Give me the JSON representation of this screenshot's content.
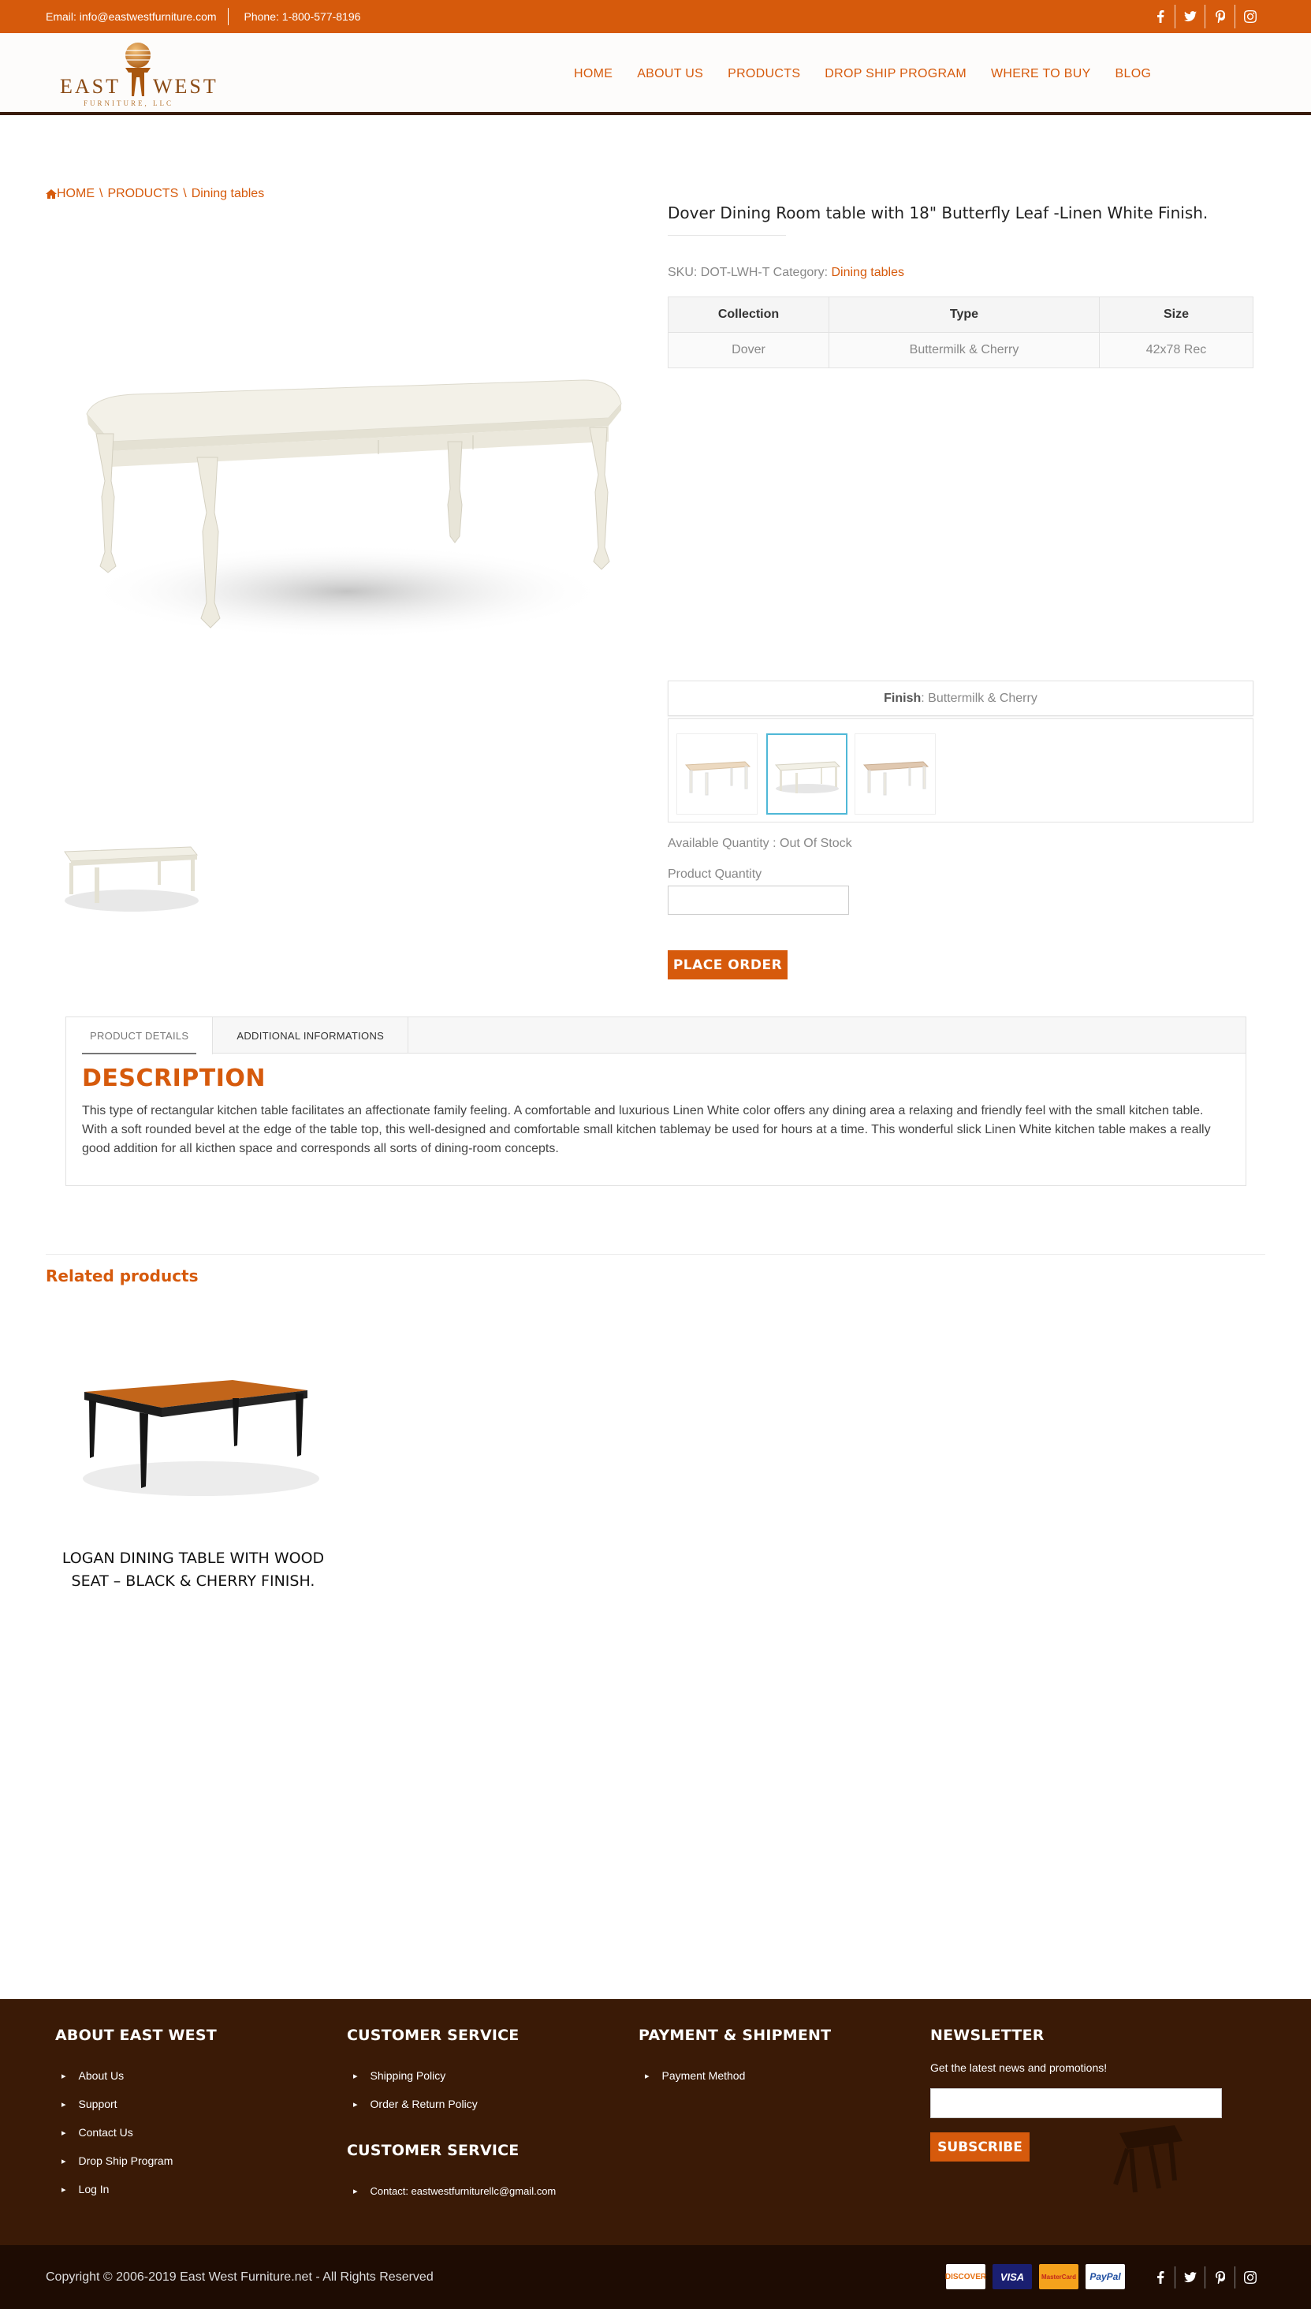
{
  "topbar": {
    "email": "Email: info@eastwestfurniture.com",
    "phone": "Phone: 1-800-577-8196",
    "social": [
      "facebook-icon",
      "twitter-icon",
      "pinterest-icon",
      "instagram-icon"
    ]
  },
  "logo": {
    "top": "EAST",
    "bottom": "WEST",
    "sub": "FURNITURE, LLC"
  },
  "nav": [
    "HOME",
    "ABOUT US",
    "PRODUCTS",
    "DROP SHIP PROGRAM",
    "WHERE TO BUY",
    "BLOG"
  ],
  "breadcrumb": {
    "home": "HOME",
    "sep": "\\",
    "products": "PRODUCTS",
    "category": "Dining tables"
  },
  "product": {
    "title": "Dover Dining Room table with 18\" Butterfly Leaf -Linen White Finish.",
    "sku_label": "SKU:",
    "sku": "DOT-LWH-T",
    "category_label": "Category:",
    "category": "Dining tables",
    "table_headers": [
      "Collection",
      "Type",
      "Size"
    ],
    "table_values": [
      "Dover",
      "Buttermilk & Cherry",
      "42x78 Rec"
    ],
    "finish_label": "Finish",
    "finish_value": ": Buttermilk & Cherry",
    "availability": "Available Quantity : Out Of Stock",
    "qty_label": "Product Quantity",
    "qty_value": "",
    "order_button": "PLACE ORDER"
  },
  "tabs": {
    "items": [
      "PRODUCT DETAILS",
      "ADDITIONAL INFORMATIONS"
    ],
    "desc_title": "DESCRIPTION",
    "desc_text": "This type of rectangular kitchen table facilitates an affectionate family feeling. A comfortable and luxurious Linen White color offers any dining area a relaxing and friendly feel with the small kitchen table. With a soft rounded bevel at the edge of the table top, this well-designed and comfortable small kitchen tablemay be used for hours at a time. This wonderful slick Linen White kitchen table makes a really good addition for all kicthen space and corresponds all sorts of dining-room concepts."
  },
  "related": {
    "title": "Related products",
    "items": [
      {
        "name": "LOGAN DINING TABLE WITH WOOD SEAT – BLACK & CHERRY FINISH."
      }
    ]
  },
  "footer": {
    "col1": {
      "title": "ABOUT EAST WEST",
      "links": [
        "About Us",
        "Support",
        "Contact Us",
        "Drop Ship Program",
        "Log In"
      ]
    },
    "col2": {
      "title": "CUSTOMER SERVICE",
      "links": [
        "Shipping Policy",
        "Order & Return Policy"
      ]
    },
    "col2b": {
      "title": "CUSTOMER SERVICE",
      "contact": "Contact:  eastwestfurniturellc@gmail.com"
    },
    "col3": {
      "title": "PAYMENT & SHIPMENT",
      "links": [
        "Payment Method"
      ]
    },
    "col4": {
      "title": "NEWSLETTER",
      "text": "Get the latest news and promotions!",
      "input_value": "",
      "button": "SUBSCRIBE"
    }
  },
  "bottom": {
    "copyright": "Copyright © 2006-2019 East West Furniture.net - All Rights Reserved",
    "cards": [
      "DISCOVER",
      "VISA",
      "MasterCard",
      "PayPal"
    ]
  },
  "colors": {
    "brand": "#d65a0c",
    "footer": "#3a1a06",
    "bottom": "#1e0c03",
    "selected_swatch": "#4fb8d7"
  }
}
